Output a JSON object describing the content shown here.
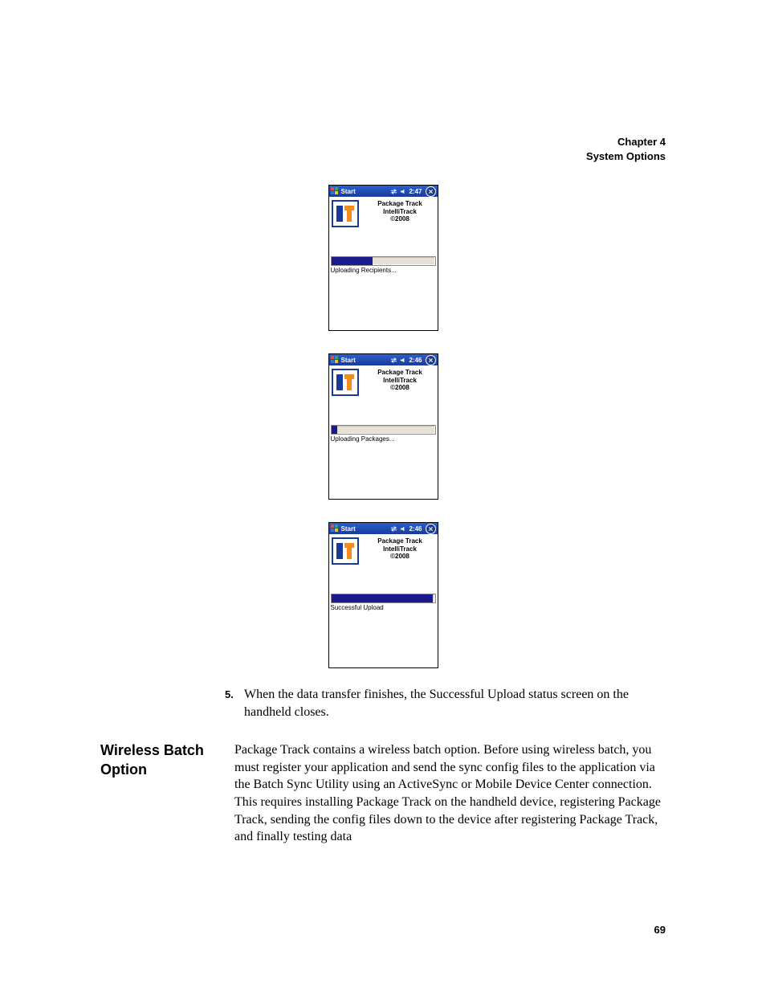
{
  "header": {
    "chapter": "Chapter 4",
    "title": "System Options"
  },
  "screens": [
    {
      "start_label": "Start",
      "time": "2:47",
      "app_line1": "Package Track",
      "app_line2": "IntelliTrack",
      "app_line3": "©2008",
      "progress_pct": 40,
      "status": "Uploading Recipients..."
    },
    {
      "start_label": "Start",
      "time": "2:46",
      "app_line1": "Package Track",
      "app_line2": "IntelliTrack",
      "app_line3": "©2008",
      "progress_pct": 6,
      "status": "Uploading Packages..."
    },
    {
      "start_label": "Start",
      "time": "2:46",
      "app_line1": "Package Track",
      "app_line2": "IntelliTrack",
      "app_line3": "©2008",
      "progress_pct": 98,
      "status": "Successful Upload"
    }
  ],
  "step": {
    "num": "5.",
    "text": "When the data transfer finishes, the Successful Upload status screen on the handheld closes."
  },
  "section": {
    "heading": "Wireless Batch Option",
    "body": "Package Track contains a wireless batch option. Before using wireless batch, you must register your application and send the sync config files to the application via the Batch Sync Utility using an ActiveSync or Mobile Device Center connection. This requires installing Package Track on the handheld device, registering Package Track, sending the config files down to the device after registering Package Track, and finally testing data"
  },
  "page_number": "69"
}
